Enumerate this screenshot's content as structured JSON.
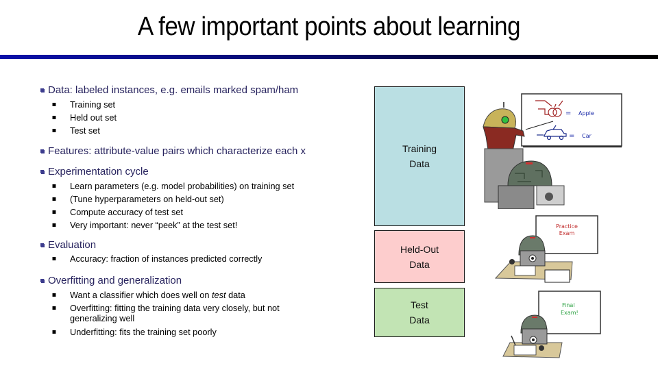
{
  "slide": {
    "title": "A few important points about learning"
  },
  "bullets": [
    {
      "text": "Data: labeled instances, e.g. emails marked spam/ham",
      "sub": [
        "Training set",
        "Held out set",
        "Test set"
      ]
    },
    {
      "text": "Features: attribute-value pairs which characterize each x",
      "sub": []
    },
    {
      "text": "Experimentation cycle",
      "sub": [
        "Learn parameters (e.g. model probabilities) on training set",
        "(Tune hyperparameters on held-out set)",
        "Compute accuracy of test set",
        "Very important: never “peek” at the test set!"
      ]
    },
    {
      "text": "Evaluation",
      "sub": [
        "Accuracy: fraction of instances predicted correctly"
      ]
    },
    {
      "text": "Overfitting and generalization",
      "sub": [
        {
          "pre": "Want a classifier which does well on ",
          "em": "test",
          "post": " data"
        },
        "Overfitting: fitting the training data very closely, but not generalizing well",
        "Underfitting: fits the training set poorly"
      ]
    }
  ],
  "data_boxes": {
    "training": {
      "line1": "Training",
      "line2": "Data",
      "color": "#badfe3"
    },
    "heldout": {
      "line1": "Held-Out",
      "line2": "Data",
      "color": "#fdcdcd"
    },
    "test": {
      "line1": "Test",
      "line2": "Data",
      "color": "#c2e4b4"
    }
  },
  "illustrations": {
    "lecture": {
      "board_word_1": "Apple",
      "board_word_2": "Car",
      "equals": "="
    },
    "practice": {
      "board_line_1": "Practice",
      "board_line_2": "Exam"
    },
    "final": {
      "board_line_1": "Final",
      "board_line_2": "Exam!"
    }
  },
  "colors": {
    "bullet_l1_text": "#27235e",
    "rule_start": "#0a10a8",
    "rule_end": "#000000"
  }
}
